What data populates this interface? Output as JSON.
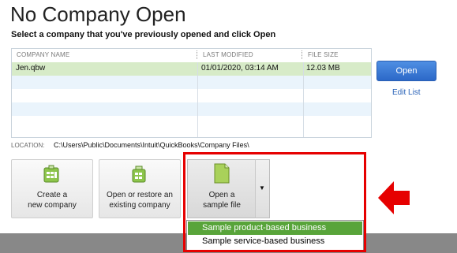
{
  "header": {
    "title": "No Company Open",
    "subtitle": "Select a company that you've previously opened and click Open"
  },
  "table": {
    "columns": [
      "COMPANY NAME",
      "LAST MODIFIED",
      "FILE SIZE"
    ],
    "rows": [
      {
        "name": "Jen.qbw",
        "modified": "01/01/2020, 03:14 AM",
        "size": "12.03 MB"
      }
    ]
  },
  "actions": {
    "open": "Open",
    "edit_list": "Edit List"
  },
  "location": {
    "label": "LOCATION:",
    "path": "C:\\Users\\Public\\Documents\\Intuit\\QuickBooks\\Company Files\\"
  },
  "tiles": {
    "create_line1": "Create a",
    "create_line2": "new company",
    "restore_line1": "Open or restore an",
    "restore_line2": "existing company",
    "sample_line1": "Open a",
    "sample_line2": "sample file"
  },
  "dropdown": {
    "arrow": "▼",
    "items": [
      {
        "label": "Sample product-based business",
        "active": true
      },
      {
        "label": "Sample service-based business",
        "active": false
      }
    ]
  },
  "colors": {
    "accent_blue": "#2c68c8",
    "selected_row": "#d7ebc8",
    "menu_highlight": "#58a43a",
    "annotation_red": "#e60000"
  }
}
